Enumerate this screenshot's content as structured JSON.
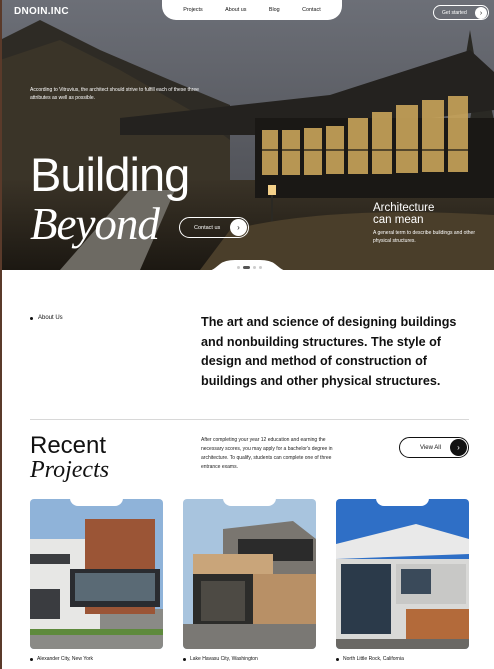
{
  "header": {
    "brand": "DNOIN.INC",
    "nav": [
      "Projects",
      "About us",
      "Blog",
      "Contact"
    ],
    "get_started": "Get started"
  },
  "hero": {
    "intro": "According to Vitruvius, the architect should strive to fulfill each of these three attributes as well as possible.",
    "headline_line1": "Building",
    "headline_line2": "Beyond",
    "contact_button": "Contact us",
    "side_title_line1": "Architecture",
    "side_title_line2": "can mean",
    "side_desc": "A general term to describe buildings and other physical structures.",
    "slide_count": 4,
    "active_slide": 1
  },
  "about": {
    "label": "About Us",
    "text": "The art and science of designing buildings and nonbuilding structures. The style of design and method of construction of buildings and other physical structures."
  },
  "projects": {
    "title_line1": "Recent",
    "title_line2": "Projects",
    "description": "After completing your year 12 education and earning the necessary scores, you may apply for a bachelor's degree in architecture. To qualify, students can complete one of three entrance exams.",
    "view_all": "View All",
    "items": [
      {
        "location": "Alexander City, New York"
      },
      {
        "location": "Lake Havasu City, Washington"
      },
      {
        "location": "North Little Rock, California"
      }
    ]
  },
  "icons": {
    "arrow": "arrow-right-icon",
    "bullet": "bullet-icon"
  },
  "colors": {
    "accent": "#111111",
    "background": "#ffffff",
    "frame": "#5a3a2a"
  }
}
